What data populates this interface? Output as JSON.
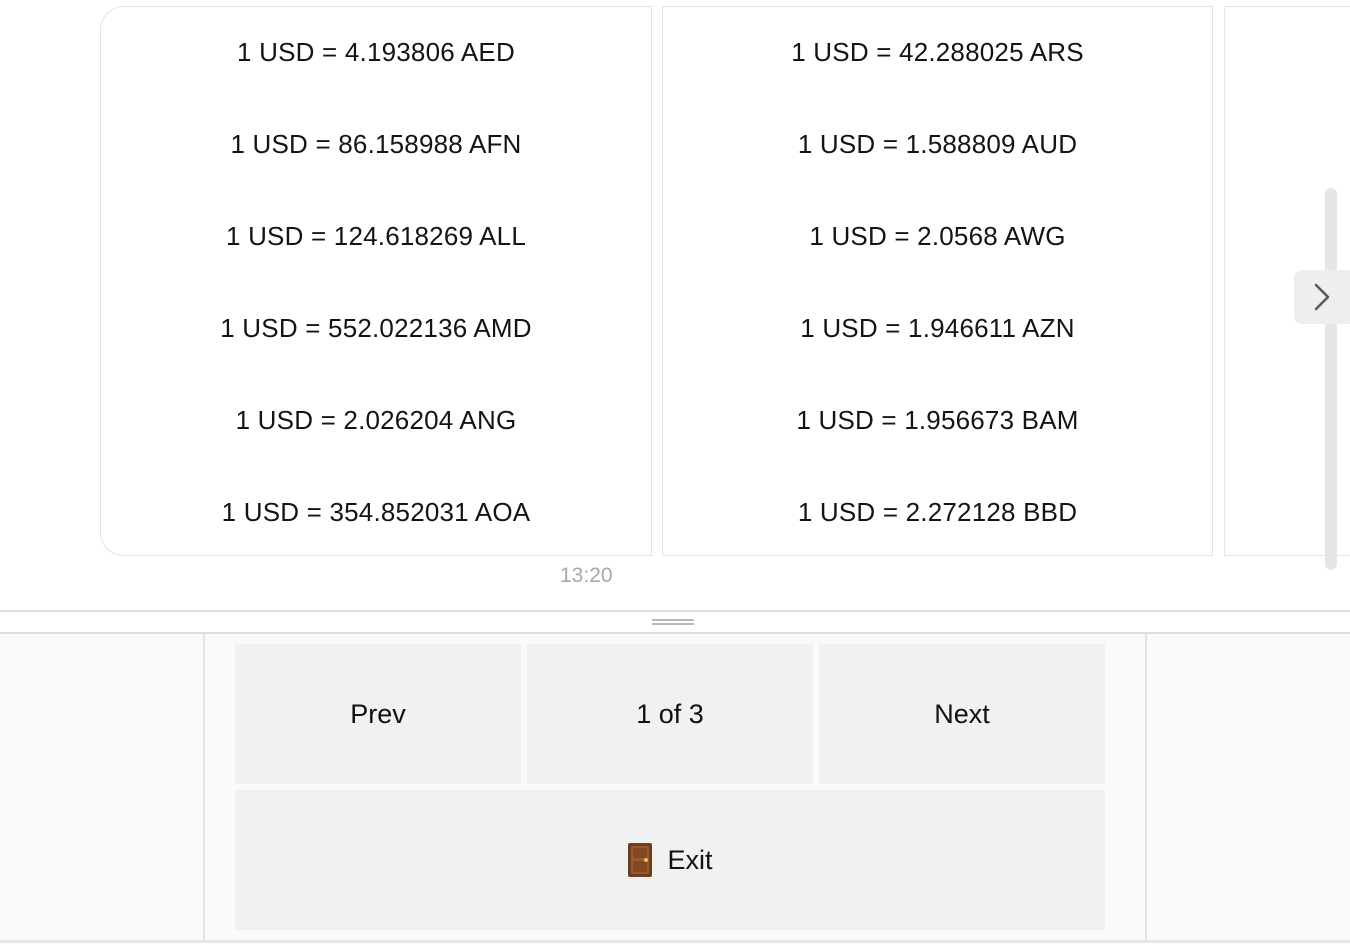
{
  "rates": {
    "column1": [
      "1 USD = 4.193806 AED",
      "1 USD = 86.158988 AFN",
      "1 USD = 124.618269 ALL",
      "1 USD = 552.022136 AMD",
      "1 USD = 2.026204 ANG",
      "1 USD = 354.852031 AOA"
    ],
    "column2": [
      "1 USD = 42.288025 ARS",
      "1 USD = 1.588809 AUD",
      "1 USD = 2.0568 AWG",
      "1 USD = 1.946611 AZN",
      "1 USD = 1.956673 BAM",
      "1 USD = 2.272128 BBD"
    ]
  },
  "message": {
    "timestamp": "13:20"
  },
  "keyboard": {
    "prev_label": "Prev",
    "page_label": "1 of 3",
    "next_label": "Next",
    "exit_label": "Exit",
    "exit_icon": "door-icon"
  },
  "icons": {
    "carousel_next": "chevron-right-icon"
  }
}
